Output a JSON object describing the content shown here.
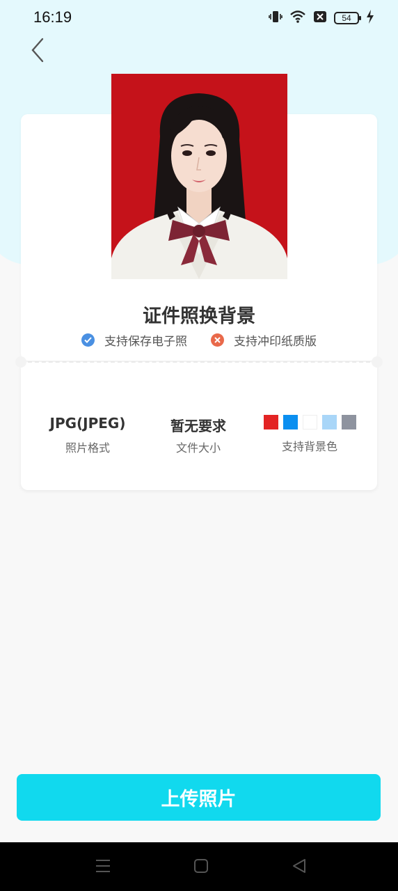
{
  "status_bar": {
    "time": "16:19",
    "battery": "54"
  },
  "icons": {
    "back": "chevron-left-icon",
    "vibrate": "vibrate-icon",
    "wifi": "wifi-icon",
    "sim": "no-sim-icon",
    "battery": "battery-icon",
    "charging": "charging-bolt-icon",
    "check": "check-circle-icon",
    "cross": "cross-circle-icon"
  },
  "title": "证件照换背景",
  "features": [
    {
      "label": "支持保存电子照",
      "supported": true
    },
    {
      "label": "支持冲印纸质版",
      "supported": false
    }
  ],
  "specs": {
    "format": {
      "value": "JPG(JPEG)",
      "label": "照片格式"
    },
    "size": {
      "value": "暂无要求",
      "label": "文件大小"
    },
    "bg": {
      "label": "支持背景色",
      "colors": [
        "#e32424",
        "#0b8ff0",
        "#ffffff",
        "#a9d6f8",
        "#8e939f"
      ]
    }
  },
  "upload_button": "上传照片",
  "colors": {
    "accent": "#11d9ee",
    "photo_bg": "#c5121a",
    "check": "#4a90e2",
    "cross": "#e9694a"
  },
  "nav": [
    "menu-icon",
    "home-icon",
    "back-triangle-icon"
  ]
}
